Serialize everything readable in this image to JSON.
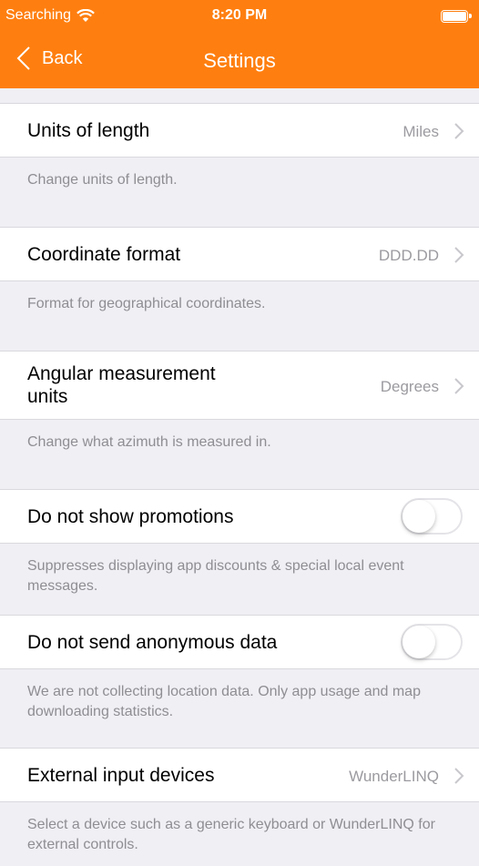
{
  "status_bar": {
    "carrier": "Searching",
    "time": "8:20 PM"
  },
  "nav": {
    "back_label": "Back",
    "title": "Settings"
  },
  "settings": {
    "units": {
      "label": "Units of length",
      "value": "Miles",
      "description": "Change units of length."
    },
    "coordinate": {
      "label": "Coordinate format",
      "value": "DDD.DD",
      "description": "Format for geographical coordinates."
    },
    "angular": {
      "label_line1": "Angular measurement",
      "label_line2": "units",
      "value": "Degrees",
      "description": "Change what azimuth is measured in."
    },
    "promotions": {
      "label": "Do not show promotions",
      "enabled": false,
      "description": "Suppresses displaying app discounts & special local event messages."
    },
    "anonymous": {
      "label": "Do not send anonymous data",
      "enabled": false,
      "description": "We are not collecting location data. Only app usage and map downloading statistics."
    },
    "external": {
      "label": "External input devices",
      "value": "WunderLINQ",
      "description": "Select a device such as a generic keyboard or WunderLINQ for external controls."
    }
  },
  "colors": {
    "accent": "#fe7f10",
    "background": "#efeff4",
    "secondary_text": "#8e8e93"
  }
}
